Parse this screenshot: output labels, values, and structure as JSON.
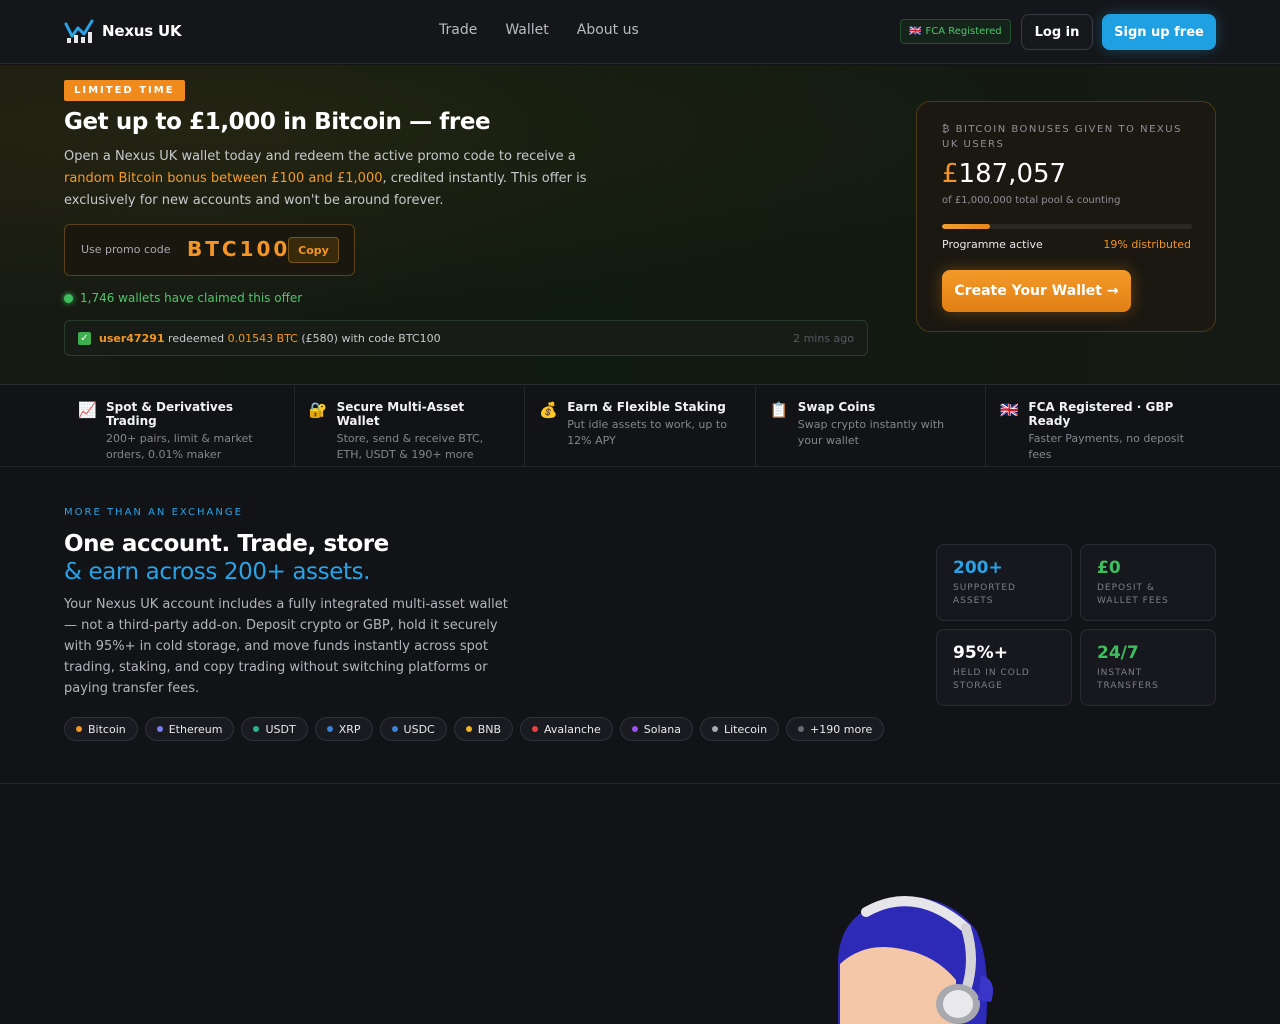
{
  "nav": {
    "brand": "Nexus UK",
    "links": [
      "Trade",
      "Wallet",
      "About us"
    ],
    "fca_badge": "FCA Registered",
    "login": "Log in",
    "signup": "Sign up free"
  },
  "hero": {
    "badge": "LIMITED TIME",
    "title": "Get up to £1,000 in Bitcoin — free",
    "desc_1": "Open a Nexus UK wallet today and redeem the active promo code to receive a ",
    "desc_highlight": "random Bitcoin bonus between £100 and £1,000",
    "desc_2": ", credited instantly. This offer is exclusively for new accounts and won't be around forever.",
    "promo_label": "Use promo code",
    "promo_code": "BTC100",
    "copy_label": "Copy",
    "claimed": "1,746 wallets have claimed this offer",
    "redeem": {
      "user": "user47291",
      "action": "redeemed",
      "amount": "0.01543 BTC",
      "gbp": "(£580) with code BTC100",
      "time": "2 mins ago"
    }
  },
  "stats": {
    "caption": "₿ BITCOIN BONUSES GIVEN TO NEXUS UK USERS",
    "currency": "£",
    "amount": "187,057",
    "sub": "of £1,000,000 total pool & counting",
    "progress_percent": 19,
    "status": "Programme active",
    "distributed": "19% distributed",
    "cta": "Create Your Wallet →"
  },
  "features": [
    {
      "icon": "chart-icon",
      "glyph": "📈",
      "title": "Spot & Derivatives Trading",
      "desc": "200+ pairs, limit & market orders, 0.01% maker"
    },
    {
      "icon": "lock-icon",
      "glyph": "🔐",
      "title": "Secure Multi-Asset Wallet",
      "desc": "Store, send & receive BTC, ETH, USDT & 190+ more"
    },
    {
      "icon": "money-bag-icon",
      "glyph": "💰",
      "title": "Earn & Flexible Staking",
      "desc": "Put idle assets to work, up to 12% APY"
    },
    {
      "icon": "clipboard-icon",
      "glyph": "📋",
      "title": "Swap Coins",
      "desc": "Swap crypto instantly with your wallet"
    },
    {
      "icon": "uk-flag-icon",
      "glyph": "🇬🇧",
      "title": "FCA Registered · GBP Ready",
      "desc": "Faster Payments, no deposit fees"
    }
  ],
  "section2": {
    "eyebrow": "MORE THAN AN EXCHANGE",
    "title_1": "One account. Trade, store",
    "title_2": "& earn across 200+ assets.",
    "desc": "Your Nexus UK account includes a fully integrated multi-asset wallet — not a third-party add-on. Deposit crypto or GBP, hold it securely with 95%+ in cold storage, and move funds instantly across spot trading, staking, and copy trading without switching platforms or paying transfer fees.",
    "chips": [
      {
        "label": "Bitcoin",
        "color": "#f29524"
      },
      {
        "label": "Ethereum",
        "color": "#7b7cf0"
      },
      {
        "label": "USDT",
        "color": "#2fb38a"
      },
      {
        "label": "XRP",
        "color": "#3a82d6"
      },
      {
        "label": "USDC",
        "color": "#3a82d6"
      },
      {
        "label": "BNB",
        "color": "#f0b224"
      },
      {
        "label": "Avalanche",
        "color": "#e84142"
      },
      {
        "label": "Solana",
        "color": "#9a52f0"
      },
      {
        "label": "Litecoin",
        "color": "#a8a9ae"
      },
      {
        "label": "+190 more",
        "color": "#6a6b71"
      }
    ],
    "tiles": [
      {
        "value": "200+",
        "label": "SUPPORTED ASSETS",
        "color": "#2aa3e6"
      },
      {
        "value": "£0",
        "label": "DEPOSIT & WALLET FEES",
        "color": "#3fbe5e"
      },
      {
        "value": "95%+",
        "label": "HELD IN COLD STORAGE",
        "color": "#ffffff"
      },
      {
        "value": "24/7",
        "label": "INSTANT TRANSFERS",
        "color": "#3fbe5e"
      }
    ]
  }
}
